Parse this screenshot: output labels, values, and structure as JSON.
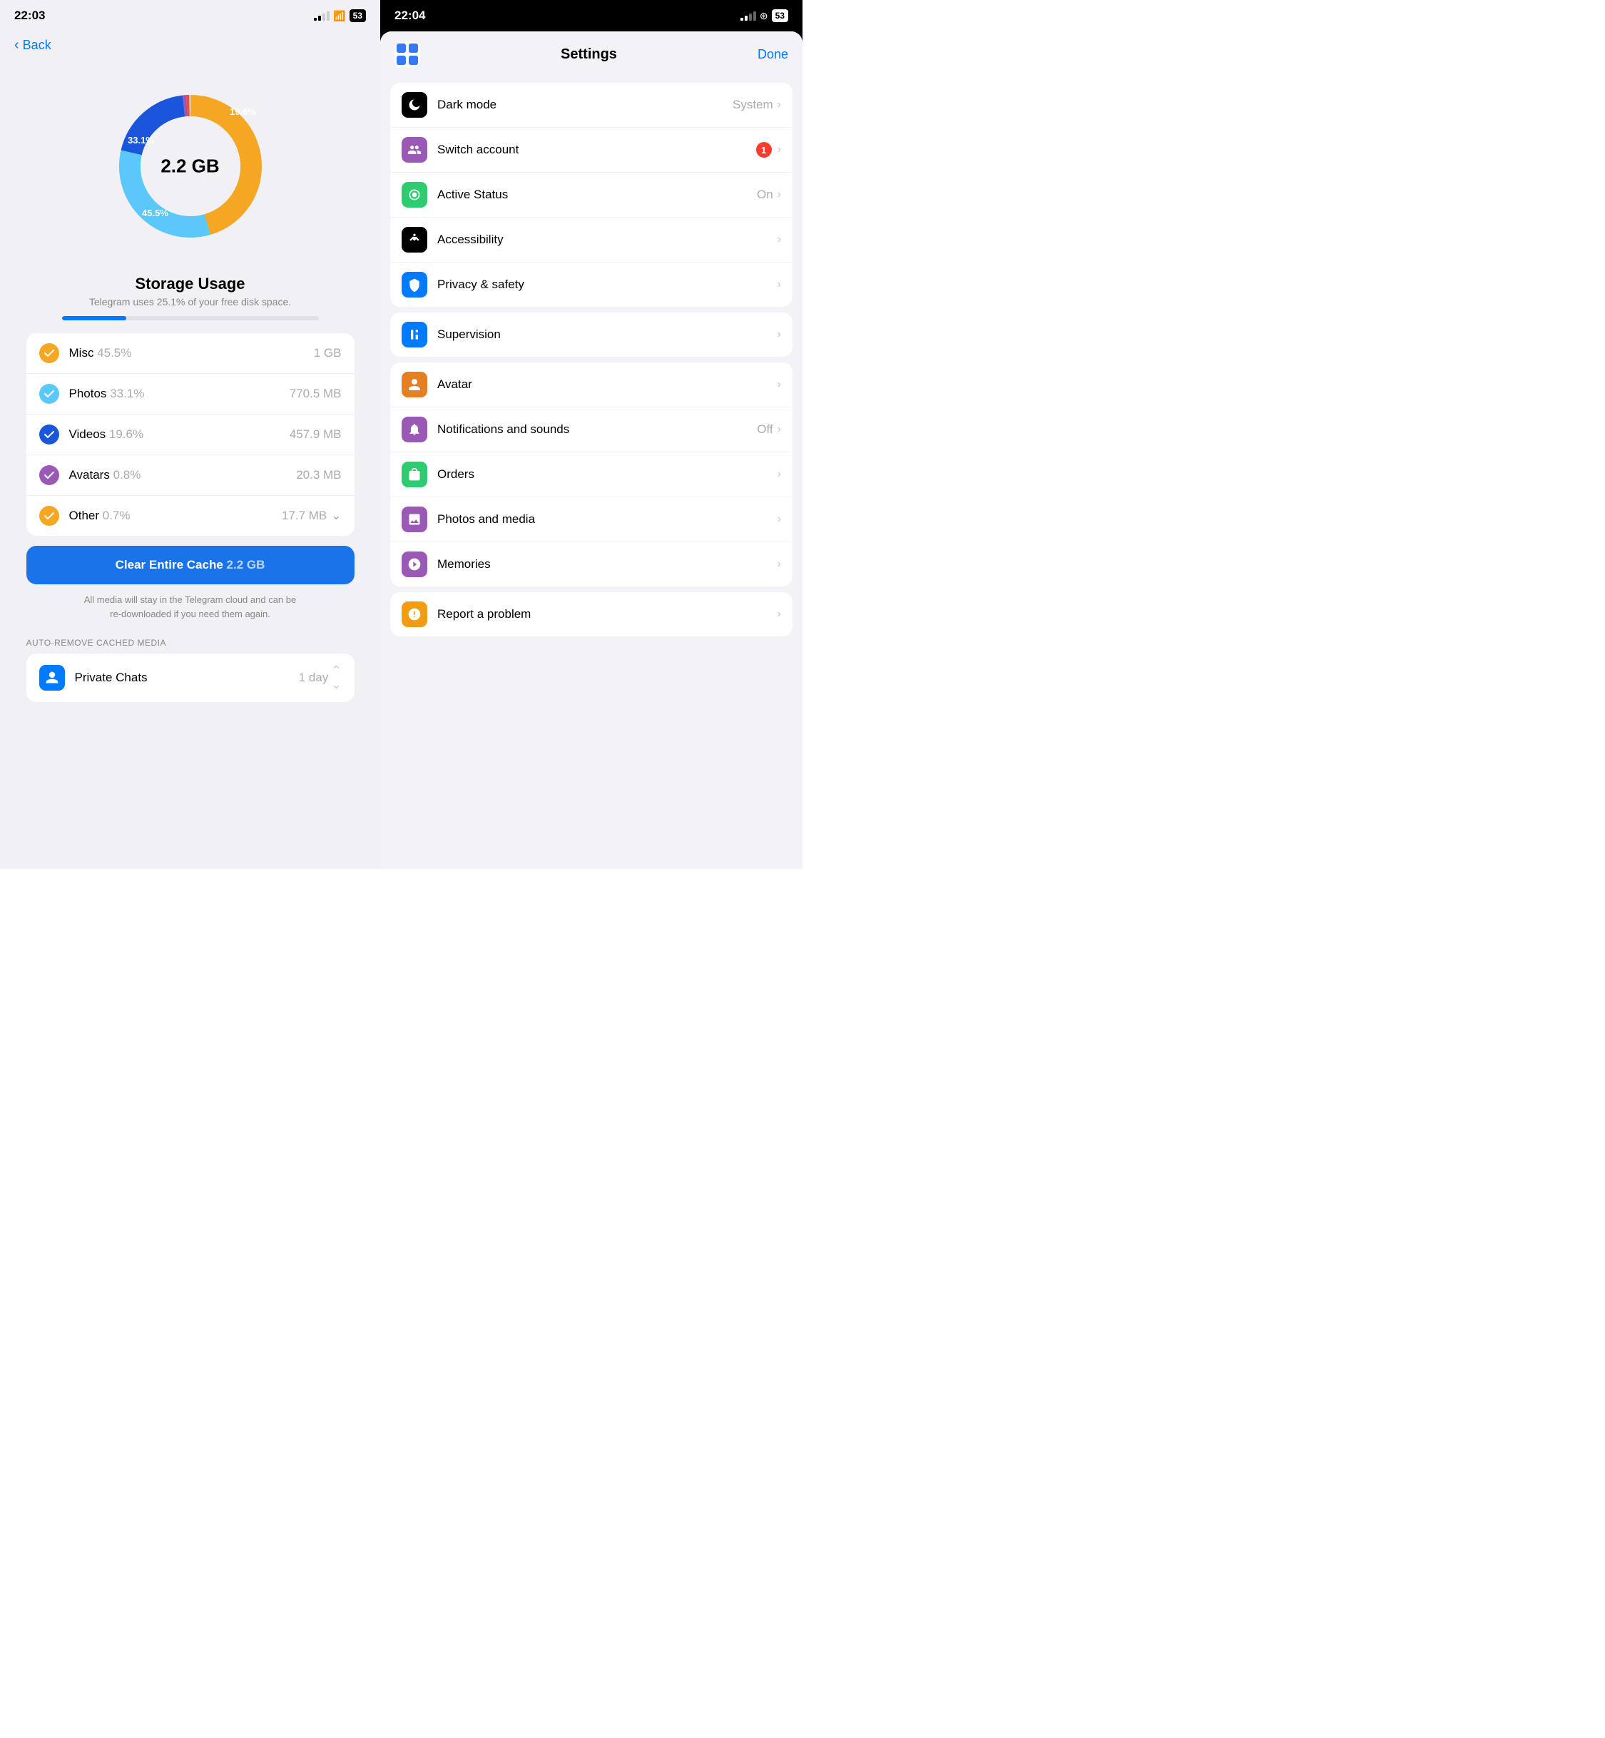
{
  "left": {
    "statusBar": {
      "time": "22:03"
    },
    "back": "Back",
    "chart": {
      "total": "2.2 GB",
      "segments": [
        {
          "label": "Misc",
          "pct": 45.5,
          "color": "#f5a623"
        },
        {
          "label": "Photos",
          "pct": 33.1,
          "color": "#5ac8fa"
        },
        {
          "label": "Videos",
          "pct": 19.6,
          "color": "#1a56db"
        },
        {
          "label": "Avatars",
          "pct": 0.8,
          "color": "#9b59b6"
        },
        {
          "label": "Other",
          "pct": 0.7,
          "color": "#e74c3c"
        }
      ],
      "labels": {
        "misc": "45.5%",
        "photos": "33.1%",
        "videos": "19.6%"
      }
    },
    "storageTitle": "Storage Usage",
    "storageSubtitle": "Telegram uses 25.1% of your free disk space.",
    "progressPct": 25.1,
    "items": [
      {
        "label": "Misc",
        "pct": "45.5%",
        "size": "1 GB",
        "color": "#f5a623"
      },
      {
        "label": "Photos",
        "pct": "33.1%",
        "size": "770.5 MB",
        "color": "#5ac8fa"
      },
      {
        "label": "Videos",
        "pct": "19.6%",
        "size": "457.9 MB",
        "color": "#1a56db"
      },
      {
        "label": "Avatars",
        "pct": "0.8%",
        "size": "20.3 MB",
        "color": "#9b59b6"
      },
      {
        "label": "Other",
        "pct": "0.7%",
        "size": "17.7 MB",
        "color": "#f5a623",
        "hasChevron": true
      }
    ],
    "clearBtn": {
      "label": "Clear Entire Cache",
      "size": "2.2 GB"
    },
    "disclaimer": "All media will stay in the Telegram cloud and can be\nre-downloaded if you need them again.",
    "sectionHeader": "AUTO-REMOVE CACHED MEDIA",
    "autoRemove": [
      {
        "label": "Private Chats",
        "value": "1 day"
      }
    ]
  },
  "right": {
    "statusBar": {
      "time": "22:04"
    },
    "header": {
      "title": "Settings",
      "done": "Done"
    },
    "groups": [
      {
        "items": [
          {
            "label": "Dark mode",
            "value": "System",
            "icon": "dark-mode",
            "iconBg": "#000",
            "hasChevron": true
          },
          {
            "label": "Switch account",
            "value": "",
            "badge": "1",
            "icon": "switch-account",
            "iconBg": "#9b59b6",
            "hasChevron": true
          },
          {
            "label": "Active Status",
            "value": "On",
            "icon": "active-status",
            "iconBg": "#2ecc71",
            "hasChevron": true
          },
          {
            "label": "Accessibility",
            "value": "",
            "icon": "accessibility",
            "iconBg": "#000",
            "hasChevron": true
          },
          {
            "label": "Privacy & safety",
            "value": "",
            "icon": "privacy-safety",
            "iconBg": "#007aff",
            "hasChevron": true
          }
        ]
      },
      {
        "items": [
          {
            "label": "Supervision",
            "value": "",
            "icon": "supervision",
            "iconBg": "#007aff",
            "hasChevron": true
          }
        ]
      },
      {
        "items": [
          {
            "label": "Avatar",
            "value": "",
            "icon": "avatar",
            "iconBg": "#e67e22",
            "hasChevron": true
          },
          {
            "label": "Notifications and sounds",
            "value": "Off",
            "icon": "notifications",
            "iconBg": "#9b59b6",
            "hasChevron": true
          },
          {
            "label": "Orders",
            "value": "",
            "icon": "orders",
            "iconBg": "#2ecc71",
            "hasChevron": true
          },
          {
            "label": "Photos and media",
            "value": "",
            "icon": "photos-media",
            "iconBg": "#9b59b6",
            "hasChevron": true
          },
          {
            "label": "Memories",
            "value": "",
            "icon": "memories",
            "iconBg": "#9b59b6",
            "hasChevron": true
          }
        ]
      },
      {
        "items": [
          {
            "label": "Report a problem",
            "value": "",
            "icon": "report",
            "iconBg": "#f39c12",
            "hasChevron": true
          }
        ]
      }
    ]
  }
}
